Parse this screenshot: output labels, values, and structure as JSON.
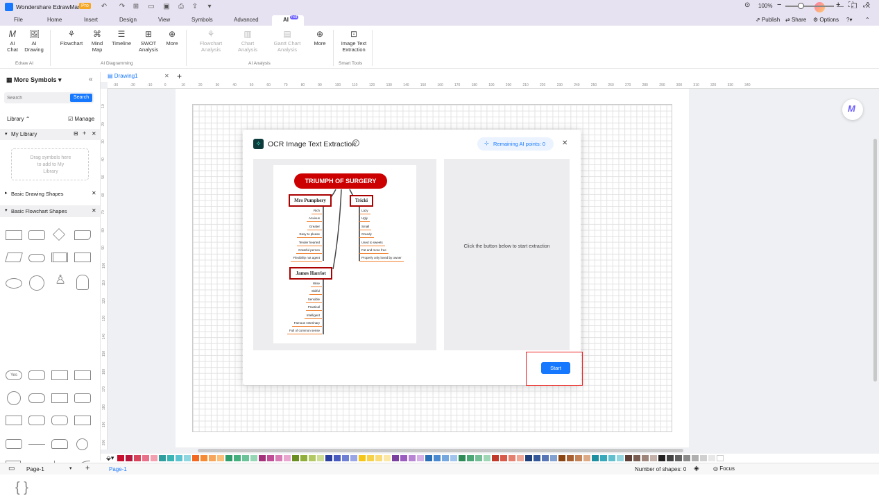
{
  "titlebar": {
    "app_name": "Wondershare EdrawMax",
    "badge": "Pro"
  },
  "menu": {
    "items": [
      "File",
      "Home",
      "Insert",
      "Design",
      "View",
      "Symbols",
      "Advanced",
      "AI"
    ],
    "ai_badge": "hot",
    "right": {
      "publish": "Publish",
      "share": "Share",
      "options": "Options"
    }
  },
  "ribbon": {
    "ai_chat": "AI Chat",
    "ai_drawing": "AI Drawing",
    "group_edraw_ai": "Edraw AI",
    "flowchart": "Flowchart",
    "mind_map": "Mind Map",
    "timeline": "Timeline",
    "swot": "SWOT Analysis",
    "more1": "More",
    "group_ai_diagramming": "AI Diagramming",
    "flowchart_analysis": "Flowchart Analysis",
    "chart_analysis": "Chart Analysis",
    "gantt_analysis": "Gantt Chart Analysis",
    "more2": "More",
    "group_ai_analysis": "AI Analysis",
    "image_text_extraction": "Image Text Extraction",
    "group_smart_tools": "Smart Tools"
  },
  "sidebar": {
    "title": "More Symbols",
    "search_placeholder": "Search",
    "search_button": "Search",
    "library": "Library",
    "manage": "Manage",
    "my_library": "My Library",
    "drop_hint": "Drag symbols here to add to My Library",
    "basic_drawing": "Basic Drawing Shapes",
    "basic_flowchart": "Basic Flowchart Shapes",
    "yes_label": "Yes"
  },
  "tabs": {
    "doc": "Drawing1"
  },
  "ruler": {
    "h": [
      "-30",
      "-20",
      "-10",
      "0",
      "10",
      "20",
      "30",
      "40",
      "50",
      "60",
      "70",
      "80",
      "90",
      "100",
      "110",
      "120",
      "130",
      "140",
      "150",
      "160",
      "170",
      "180",
      "190",
      "200",
      "210",
      "220",
      "230",
      "240",
      "250",
      "260",
      "270",
      "280",
      "290",
      "300",
      "310",
      "320",
      "330",
      "340"
    ],
    "v": [
      "10",
      "20",
      "30",
      "40",
      "50",
      "60",
      "70",
      "80",
      "90",
      "100",
      "110",
      "120",
      "130",
      "140",
      "150",
      "160",
      "170",
      "180",
      "190",
      "200"
    ]
  },
  "dialog": {
    "title": "OCR Image Text Extraction",
    "points": "Remaining AI points: 0",
    "hint": "Click the button below to start extraction",
    "start": "Start"
  },
  "mindmap": {
    "title": "TRIUMPH OF SURGERY",
    "node1": "Mrs Pumphery",
    "node2": "Tricki",
    "node3": "James Harriot",
    "left1": [
      "Rich",
      "Anxious",
      "Greater",
      "Easy to please",
      "Tender hearted",
      "Grateful person",
      "Flexibility not agent"
    ],
    "right1": [
      "Lazy",
      "Ugly",
      "Small",
      "Greedy",
      "Used to sweets",
      "Fat and more free",
      "Properly only loved by owner"
    ],
    "left2": [
      "Wise",
      "Skilful",
      "Sensible",
      "Practical",
      "Intelligent",
      "Famous veterinary",
      "Full of common sense"
    ]
  },
  "colors": {
    "accent": "#1677ff",
    "highlight": "#e22",
    "swatches": [
      "#c8102e",
      "#b5173d",
      "#d6455b",
      "#e8728a",
      "#f2a0b0",
      "#2f9e9e",
      "#3ab5b5",
      "#5bc4d0",
      "#8ed7e0",
      "#f26a21",
      "#f58c35",
      "#f7a55a",
      "#fbbf7c",
      "#2e9c6b",
      "#45b07d",
      "#6bc499",
      "#95d6b5",
      "#a3327a",
      "#c04d96",
      "#d97bb5",
      "#e9a6cf",
      "#6b8e23",
      "#8fae3c",
      "#b2c865",
      "#cddd95",
      "#2c3e9e",
      "#4a5bc0",
      "#6e7fd4",
      "#9aa6e3",
      "#f5c518",
      "#f7d14a",
      "#f9dc78",
      "#fbe8a6",
      "#7b3fa0",
      "#9b5cc0",
      "#b885d4",
      "#d4b0e6",
      "#2a6fb5",
      "#4b8ad0",
      "#76a8df",
      "#a1c4ec",
      "#2e8b57",
      "#4ca777",
      "#74bf96",
      "#9ed6b6",
      "#c0392b",
      "#d75a4a",
      "#e4806f",
      "#eea898",
      "#1f3f7a",
      "#34589a",
      "#5875b5",
      "#82a0d0",
      "#8b4513",
      "#a86032",
      "#c58458",
      "#dcab86",
      "#1c8fa0",
      "#37a9ba",
      "#62c0ce",
      "#93d6df",
      "#5d4037",
      "#7b5e53",
      "#9e857b",
      "#c3b1aa",
      "#212121",
      "#424242",
      "#616161",
      "#8a8a8a",
      "#b0b0b0",
      "#d0d0d0",
      "#e8e8e8",
      "#ffffff"
    ]
  },
  "status": {
    "page_tab": "Page-1",
    "page_tab2": "Page-1",
    "shapes": "Number of shapes: 0",
    "focus": "Focus",
    "zoom": "100%"
  }
}
